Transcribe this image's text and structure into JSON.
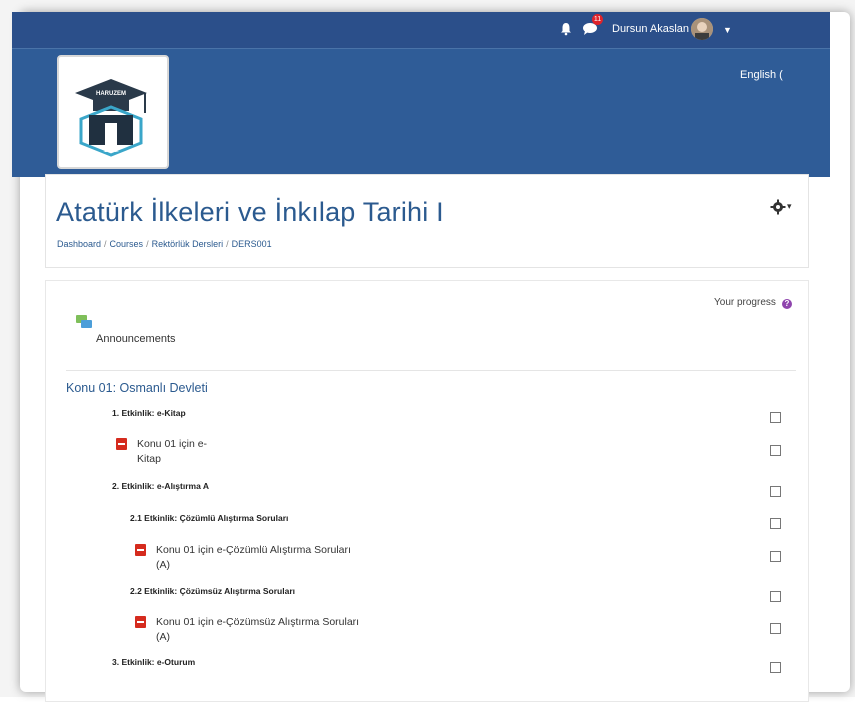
{
  "topbar": {
    "notification_count": "11",
    "user_name": "Dursun Akaslan"
  },
  "header": {
    "language": "English (",
    "logo_text_top": "HARUZEM",
    "logo_year": "1992"
  },
  "course": {
    "title": "Atatürk İlkeleri ve İnkılap Tarihi I",
    "breadcrumb": [
      "Dashboard",
      "Courses",
      "Rektörlük Dersleri",
      "DERS001"
    ]
  },
  "content": {
    "progress_label": "Your progress",
    "announcements_label": "Announcements",
    "section_title": "Konu 01: Osmanlı Devleti",
    "items": [
      {
        "type": "label",
        "text": "1. Etkinlik: e-Kitap"
      },
      {
        "type": "resource",
        "line1": "Konu 01 için e-",
        "line2": "Kitap"
      },
      {
        "type": "label",
        "text": "2. Etkinlik: e-Alıştırma A"
      },
      {
        "type": "label",
        "text": "2.1 Etkinlik: Çözümlü Alıştırma Soruları"
      },
      {
        "type": "resource",
        "line1": "Konu 01 için e-Çözümlü Alıştırma Soruları",
        "line2": "(A)"
      },
      {
        "type": "label",
        "text": "2.2 Etkinlik: Çözümsüz Alıştırma Soruları"
      },
      {
        "type": "resource",
        "line1": "Konu 01 için e-Çözümsüz Alıştırma Soruları",
        "line2": "(A)"
      },
      {
        "type": "label",
        "text": "3. Etkinlik: e-Oturum"
      }
    ]
  },
  "colors": {
    "topbar": "#2b4f8a",
    "header": "#2f5c97",
    "link": "#2b5a8f",
    "pdf": "#d52b1e"
  }
}
